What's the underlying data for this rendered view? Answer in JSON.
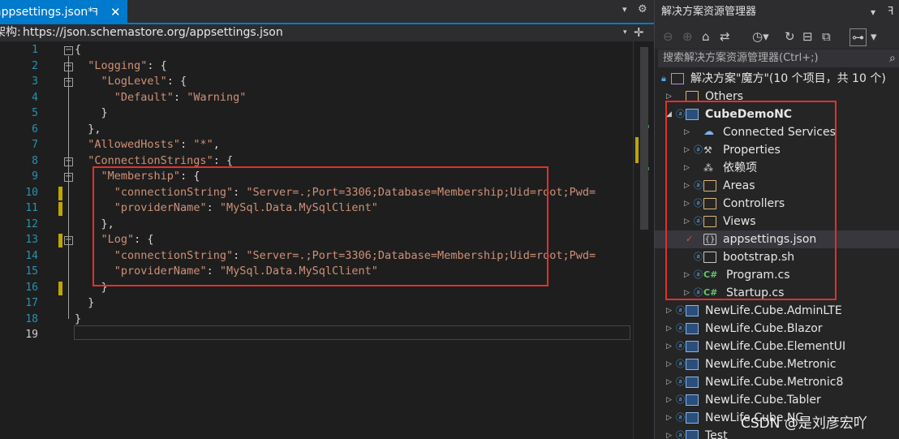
{
  "editor": {
    "tab": {
      "title": "appsettings.json*",
      "pin": "ꟻ",
      "close": "✕"
    },
    "tab_dropdown": "▾",
    "tab_settings": "⚙",
    "schema": {
      "label": "架构:",
      "url": "https://json.schemastore.org/appsettings.json",
      "drop": "▾",
      "split": "✛"
    },
    "line_numbers": [
      "1",
      "2",
      "3",
      "4",
      "5",
      "6",
      "7",
      "8",
      "9",
      "10",
      "11",
      "12",
      "13",
      "14",
      "15",
      "16",
      "17",
      "18",
      "19"
    ],
    "lines": [
      "{",
      "  \"Logging\": {",
      "    \"LogLevel\": {",
      "      \"Default\": \"Warning\"",
      "    }",
      "  },",
      "  \"AllowedHosts\": \"*\",",
      "  \"ConnectionStrings\": {",
      "    \"Membership\": {",
      "      \"connectionString\": \"Server=.;Port=3306;Database=Membership;Uid=root;Pwd=",
      "      \"providerName\": \"MySql.Data.MySqlClient\"",
      "    },",
      "    \"Log\": {",
      "      \"connectionString\": \"Server=.;Port=3306;Database=Membership;Uid=root;Pwd=",
      "      \"providerName\": \"MySql.Data.MySqlClient\"",
      "    }",
      "  }",
      "}",
      ""
    ]
  },
  "solution_explorer": {
    "title": "解决方案资源管理器",
    "title_controls": {
      "dropdown": "▾",
      "pin": "ꟻ"
    },
    "search_placeholder": "搜索解决方案资源管理器(Ctrl+;)",
    "search_icon": "⌕",
    "solution_label": "解决方案\"魔方\"(10 个项目，共 10 个)",
    "items": [
      {
        "label": "Others",
        "icon": "folder-icon"
      },
      {
        "label": "CubeDemoNC",
        "icon": "web-project-icon"
      },
      {
        "label": "Connected Services",
        "icon": "connected-services-icon"
      },
      {
        "label": "Properties",
        "icon": "properties-icon"
      },
      {
        "label": "依赖项",
        "icon": "dependencies-icon"
      },
      {
        "label": "Areas",
        "icon": "folder-icon"
      },
      {
        "label": "Controllers",
        "icon": "folder-icon"
      },
      {
        "label": "Views",
        "icon": "folder-icon"
      },
      {
        "label": "appsettings.json",
        "icon": "json-file-icon"
      },
      {
        "label": "bootstrap.sh",
        "icon": "file-icon"
      },
      {
        "label": "Program.cs",
        "icon": "csharp-file-icon"
      },
      {
        "label": "Startup.cs",
        "icon": "csharp-file-icon"
      },
      {
        "label": "NewLife.Cube.AdminLTE",
        "icon": "web-project-icon"
      },
      {
        "label": "NewLife.Cube.Blazor",
        "icon": "web-project-icon"
      },
      {
        "label": "NewLife.Cube.ElementUI",
        "icon": "web-project-icon"
      },
      {
        "label": "NewLife.Cube.Metronic",
        "icon": "web-project-icon"
      },
      {
        "label": "NewLife.Cube.Metronic8",
        "icon": "web-project-icon"
      },
      {
        "label": "NewLife.Cube.Tabler",
        "icon": "web-project-icon"
      },
      {
        "label": "NewLife.Cube.NC",
        "icon": "web-project-icon"
      },
      {
        "label": "Test",
        "icon": "console-project-icon"
      }
    ],
    "cs_badge": "C#",
    "json_badge": "{}"
  },
  "watermark": "CSDN @是刘彦宏吖",
  "colors": {
    "accent": "#007acc",
    "highlight_box": "#e03030",
    "string": "#ce9178",
    "line_number": "#2b91af"
  }
}
